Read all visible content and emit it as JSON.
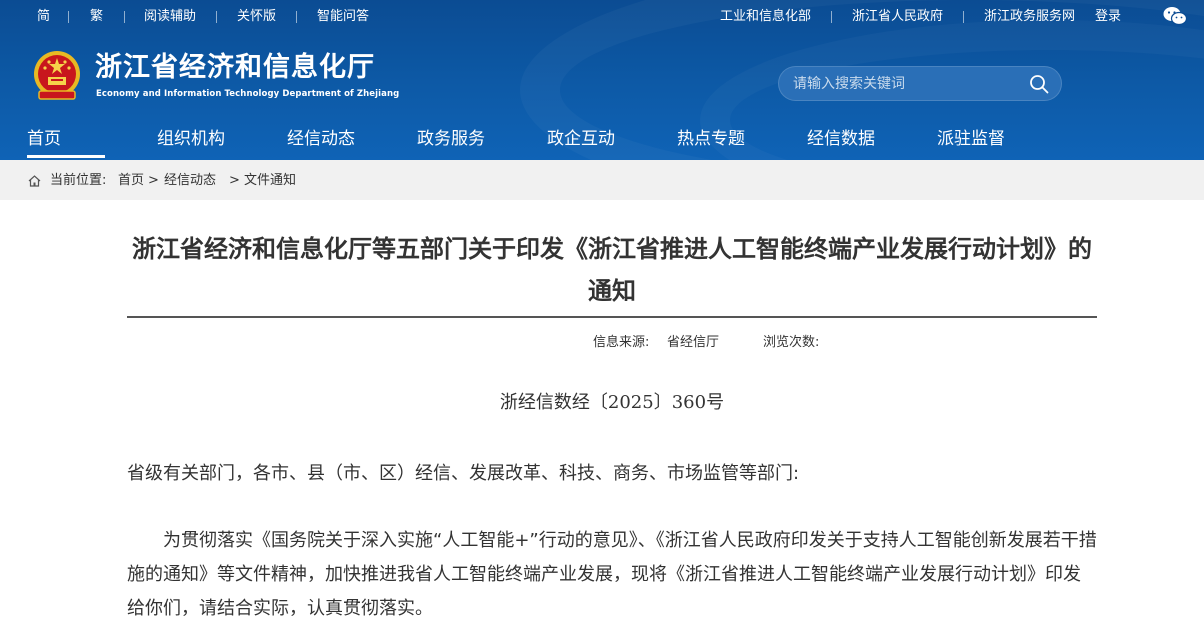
{
  "topbar": {
    "simplified": "简",
    "traditional": "繁",
    "reading_aid": "阅读辅助",
    "care_mode": "关怀版",
    "smart_qa": "智能问答",
    "miit": "工业和信息化部",
    "zj_gov": "浙江省人民政府",
    "zj_services": "浙江政务服务网",
    "login": "登录"
  },
  "site": {
    "title_cn": "浙江省经济和信息化厅",
    "title_en": "Economy and Information Technology Department of Zhejiang"
  },
  "search": {
    "placeholder": "请输入搜索关键词"
  },
  "nav": {
    "items": [
      {
        "label": "首页",
        "active": true
      },
      {
        "label": "组织机构"
      },
      {
        "label": "经信动态"
      },
      {
        "label": "政务服务"
      },
      {
        "label": "政企互动"
      },
      {
        "label": "热点专题"
      },
      {
        "label": "经信数据"
      },
      {
        "label": "派驻监督"
      }
    ]
  },
  "breadcrumb": {
    "prefix": "当前位置:",
    "home": "首页",
    "sep1": ">",
    "section": "经信动态",
    "sep2": ">",
    "current": "文件通知"
  },
  "article": {
    "title": "浙江省经济和信息化厅等五部门关于印发《浙江省推进人工智能终端产业发展行动计划》的通知",
    "source_label": "信息来源:",
    "source_value": "省经信厅",
    "views_label": "浏览次数:",
    "doc_number": "浙经信数经〔2025〕360号",
    "addressee": "省级有关部门，各市、县（市、区）经信、发展改革、科技、商务、市场监管等部门:",
    "body": "为贯彻落实《国务院关于深入实施“人工智能+”行动的意见》、《浙江省人民政府印发关于支持人工智能创新发展若干措施的通知》等文件精神，加快推进我省人工智能终端产业发展，现将《浙江省推进人工智能终端产业发展行动计划》印发给你们，请结合实际，认真贯彻落实。"
  },
  "colors": {
    "header_blue": "#0d5aa7",
    "search_bg": "#2a6fb7",
    "crumb_bg": "#f1f1f1",
    "text": "#333333"
  }
}
